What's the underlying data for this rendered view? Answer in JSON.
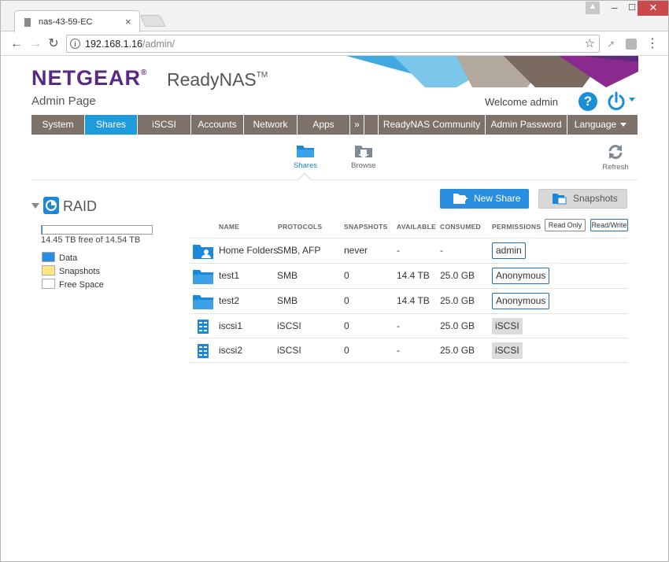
{
  "browser": {
    "tab_title": "nas-43-59-EC",
    "tab_close": "×",
    "url_host": "192.168.1.16",
    "url_path": "/admin/",
    "buttons": {
      "back": "←",
      "forward": "→",
      "reload": "↻",
      "star": "☆",
      "menu": "⋮",
      "minimize": "‒",
      "maximize": "☐",
      "close": "✕"
    }
  },
  "app": {
    "brand": "NETGEAR",
    "brand_mark": "®",
    "product": "ReadyNAS",
    "product_mark": "TM",
    "subtitle": "Admin Page",
    "welcome": "Welcome admin",
    "help_label": "?",
    "accent_color": "#1e9bdb",
    "brand_color": "#5a2a82"
  },
  "menu": {
    "items": [
      {
        "label": "System"
      },
      {
        "label": "Shares"
      },
      {
        "label": "iSCSI"
      },
      {
        "label": "Accounts"
      },
      {
        "label": "Network"
      },
      {
        "label": "Apps"
      },
      {
        "label": "»"
      },
      {
        "label": "ReadyNAS Community"
      },
      {
        "label": "Admin Password"
      },
      {
        "label": "Language"
      }
    ],
    "active": "Shares"
  },
  "subnav": {
    "shares": "Shares",
    "browse": "Browse",
    "refresh": "Refresh"
  },
  "raid": {
    "title": "RAID",
    "capacity_text": "14.45 TB free of 14.54 TB",
    "used_fraction": 0.006,
    "legend": [
      {
        "label": "Data",
        "color": "#2a8ee0"
      },
      {
        "label": "Snapshots",
        "color": "#ffe680"
      },
      {
        "label": "Free Space",
        "color": "#ffffff"
      }
    ]
  },
  "actions": {
    "new_share": "New Share",
    "snapshots": "Snapshots"
  },
  "table": {
    "headers": {
      "name": "NAME",
      "protocols": "PROTOCOLS",
      "snapshots": "SNAPSHOTS",
      "available": "AVAILABLE",
      "consumed": "CONSUMED",
      "permissions": "PERMISSIONS"
    },
    "perm_filters": {
      "read_only": "Read Only",
      "read_write": "Read/Write"
    },
    "rows": [
      {
        "icon": "home-folder-icon",
        "name": "Home Folders",
        "protocols": "SMB, AFP",
        "snapshots": "never",
        "available": "-",
        "consumed": "-",
        "permission": "admin"
      },
      {
        "icon": "folder-icon",
        "name": "test1",
        "protocols": "SMB",
        "snapshots": "0",
        "available": "14.4 TB",
        "consumed": "25.0 GB",
        "permission": "Anonymous"
      },
      {
        "icon": "folder-icon",
        "name": "test2",
        "protocols": "SMB",
        "snapshots": "0",
        "available": "14.4 TB",
        "consumed": "25.0 GB",
        "permission": "Anonymous"
      },
      {
        "icon": "iscsi-lun-icon",
        "name": "iscsi1",
        "protocols": "iSCSI",
        "snapshots": "0",
        "available": "-",
        "consumed": "25.0 GB",
        "permission": "iSCSI"
      },
      {
        "icon": "iscsi-lun-icon",
        "name": "iscsi2",
        "protocols": "iSCSI",
        "snapshots": "0",
        "available": "-",
        "consumed": "25.0 GB",
        "permission": "iSCSI"
      }
    ]
  }
}
